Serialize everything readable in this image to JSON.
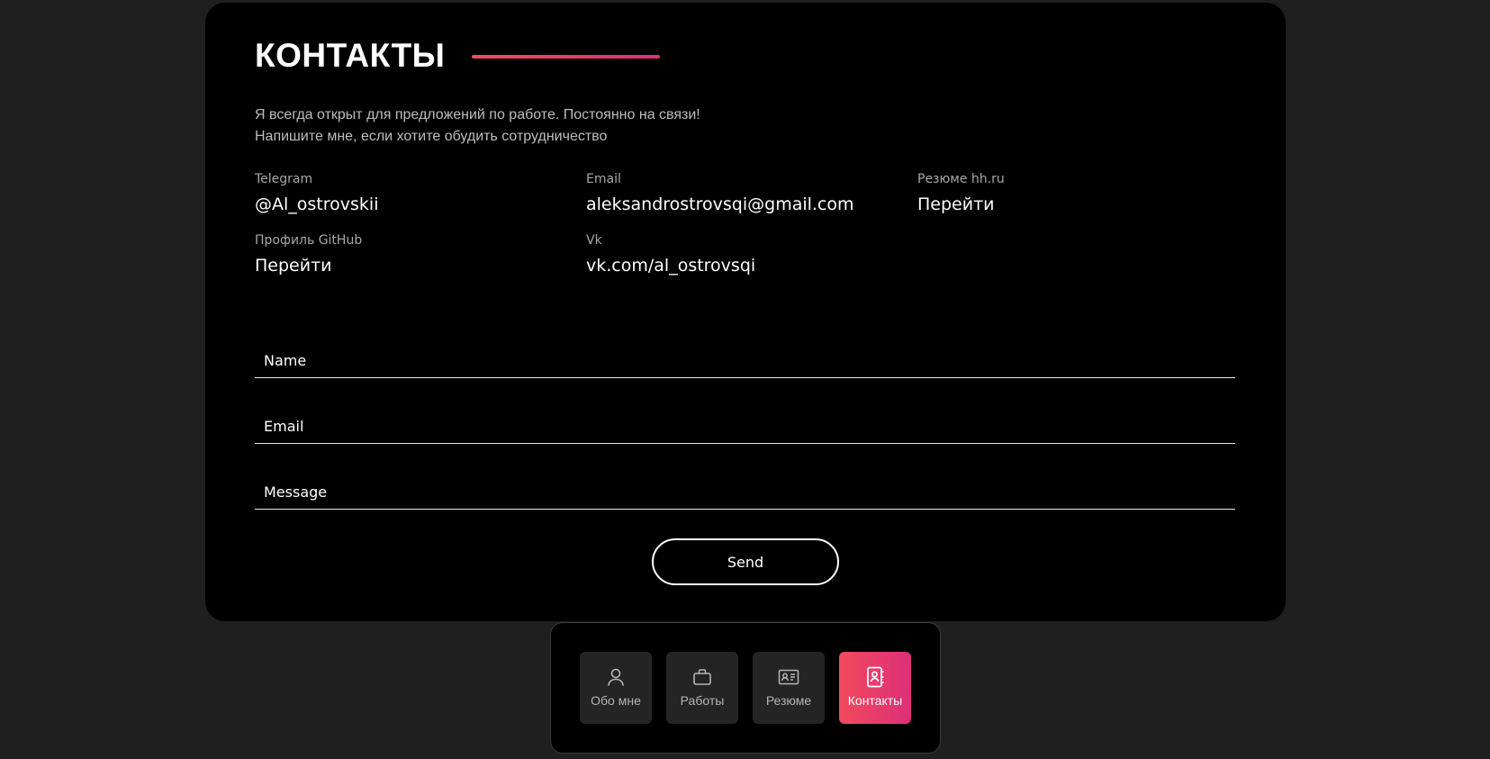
{
  "section": {
    "title": "КОНТАКТЫ",
    "intro_line1": "Я всегда открыт для предложений по работе. Постоянно на связи!",
    "intro_line2": "Напишите мне, если хотите обудить сотрудничество"
  },
  "contacts": [
    {
      "label": "Telegram",
      "value": "@Al_ostrovskii"
    },
    {
      "label": "Email",
      "value": "aleksandrostrovsqi@gmail.com"
    },
    {
      "label": "Резюме hh.ru",
      "value": "Перейти"
    },
    {
      "label": "Профиль GitHub",
      "value": "Перейти"
    },
    {
      "label": "Vk",
      "value": "vk.com/al_ostrovsqi"
    }
  ],
  "form": {
    "name_placeholder": "Name",
    "email_placeholder": "Email",
    "message_placeholder": "Message",
    "send_label": "Send"
  },
  "nav": {
    "items": [
      {
        "label": "Обо мне",
        "icon": "user-icon"
      },
      {
        "label": "Работы",
        "icon": "briefcase-icon"
      },
      {
        "label": "Резюме",
        "icon": "id-card-icon"
      },
      {
        "label": "Контакты",
        "icon": "contacts-book-icon",
        "active": true
      }
    ]
  },
  "colors": {
    "accent_start": "#f24a5e",
    "accent_end": "#dd2f78",
    "page_bg": "#1f1f1f",
    "card_bg": "#000000"
  }
}
